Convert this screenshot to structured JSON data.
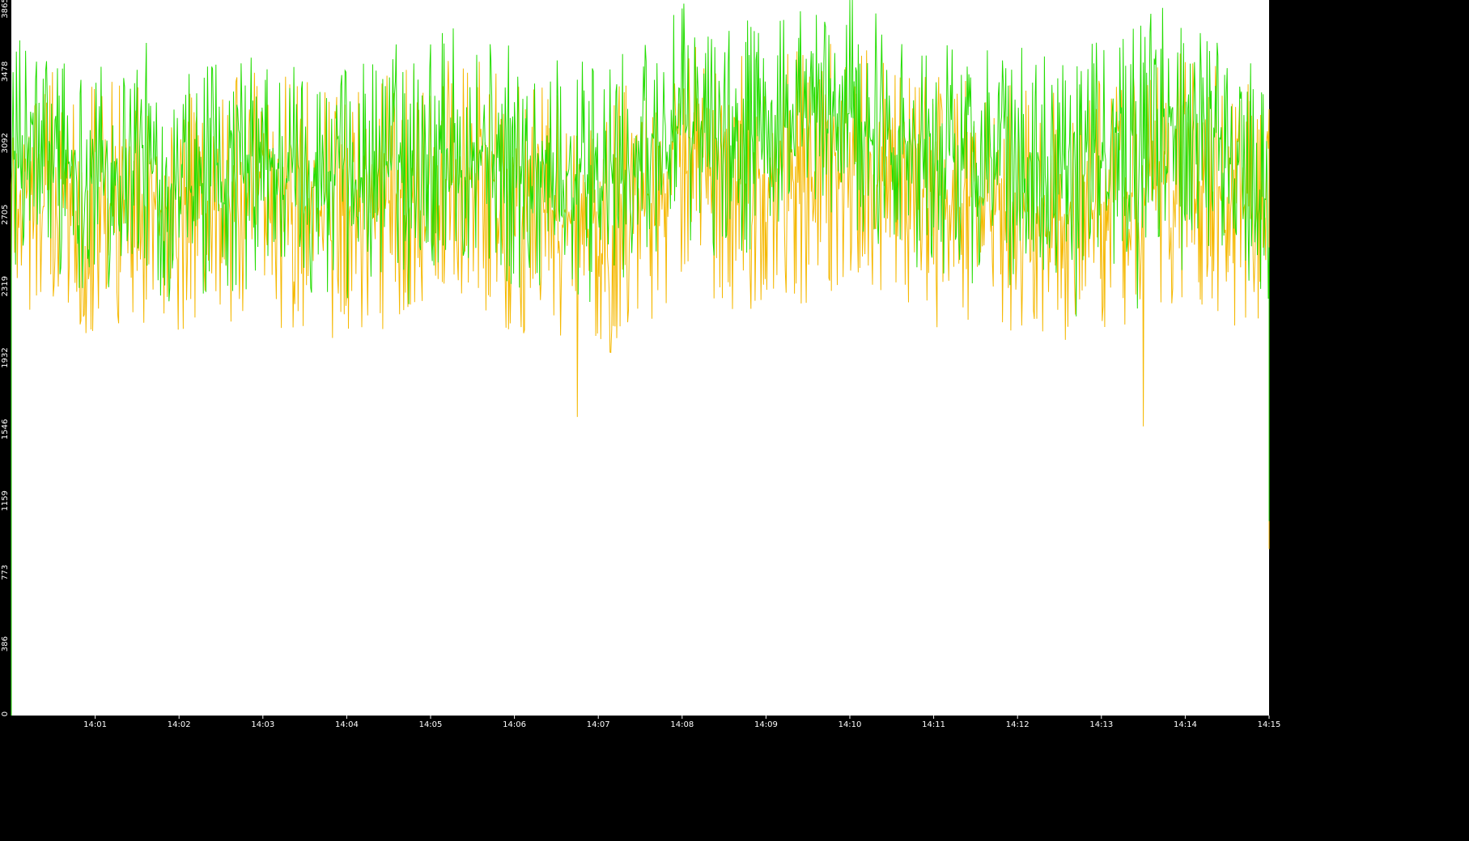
{
  "chart_data": {
    "type": "line",
    "title": "",
    "xlabel": "",
    "ylabel": "",
    "background": "#000000",
    "plot_background": "#ffffff",
    "grid": false,
    "legend": "none",
    "xlim": [
      "14:00:00",
      "14:15:00"
    ],
    "ylim": [
      0,
      3865
    ],
    "x_tick_labels": [
      "14:01",
      "14:02",
      "14:03",
      "14:04",
      "14:05",
      "14:06",
      "14:07",
      "14:08",
      "14:09",
      "14:10",
      "14:11",
      "14:12",
      "14:13",
      "14:14",
      "14:15"
    ],
    "y_tick_labels": [
      "0",
      "386",
      "773",
      "1159",
      "1546",
      "1932",
      "2319",
      "2705",
      "3092",
      "3478",
      "3865"
    ],
    "series": [
      {
        "color": "#22dd00",
        "x": [
          "14:00:00",
          "14:00:30",
          "14:01:00",
          "14:01:30",
          "14:02:00",
          "14:02:30",
          "14:03:00",
          "14:03:30",
          "14:04:00",
          "14:04:30",
          "14:05:00",
          "14:05:30",
          "14:06:00",
          "14:06:30",
          "14:07:00",
          "14:07:30",
          "14:08:00",
          "14:08:30",
          "14:09:00",
          "14:09:30",
          "14:10:00",
          "14:10:30",
          "14:11:00",
          "14:11:30",
          "14:12:00",
          "14:12:30",
          "14:13:00",
          "14:13:30",
          "14:14:00",
          "14:14:30",
          "14:15:00"
        ],
        "values": [
          3000,
          3050,
          2900,
          3050,
          2800,
          2900,
          2950,
          2950,
          2850,
          3000,
          3050,
          3100,
          2950,
          2950,
          2850,
          3000,
          3200,
          3100,
          3150,
          3200,
          3250,
          3150,
          3000,
          3050,
          2950,
          3050,
          3000,
          3200,
          3250,
          3050,
          2750
        ],
        "min": 2100,
        "max": 3865
      },
      {
        "color": "#f5b800",
        "x": [
          "14:00:00",
          "14:00:30",
          "14:01:00",
          "14:01:30",
          "14:02:00",
          "14:02:30",
          "14:03:00",
          "14:03:30",
          "14:04:00",
          "14:04:30",
          "14:05:00",
          "14:05:30",
          "14:06:00",
          "14:06:30",
          "14:07:00",
          "14:07:30",
          "14:08:00",
          "14:08:30",
          "14:09:00",
          "14:09:30",
          "14:10:00",
          "14:10:30",
          "14:11:00",
          "14:11:30",
          "14:12:00",
          "14:12:30",
          "14:13:00",
          "14:13:30",
          "14:14:00",
          "14:14:30",
          "14:15:00"
        ],
        "values": [
          2850,
          2800,
          2750,
          2800,
          2650,
          2750,
          2800,
          2750,
          2700,
          2800,
          2850,
          2900,
          2750,
          2700,
          2600,
          2800,
          2950,
          2850,
          2900,
          2900,
          3000,
          2850,
          2750,
          2750,
          2700,
          2700,
          2750,
          2850,
          2900,
          2800,
          2650
        ],
        "min": 1550,
        "max": 3640
      }
    ]
  }
}
